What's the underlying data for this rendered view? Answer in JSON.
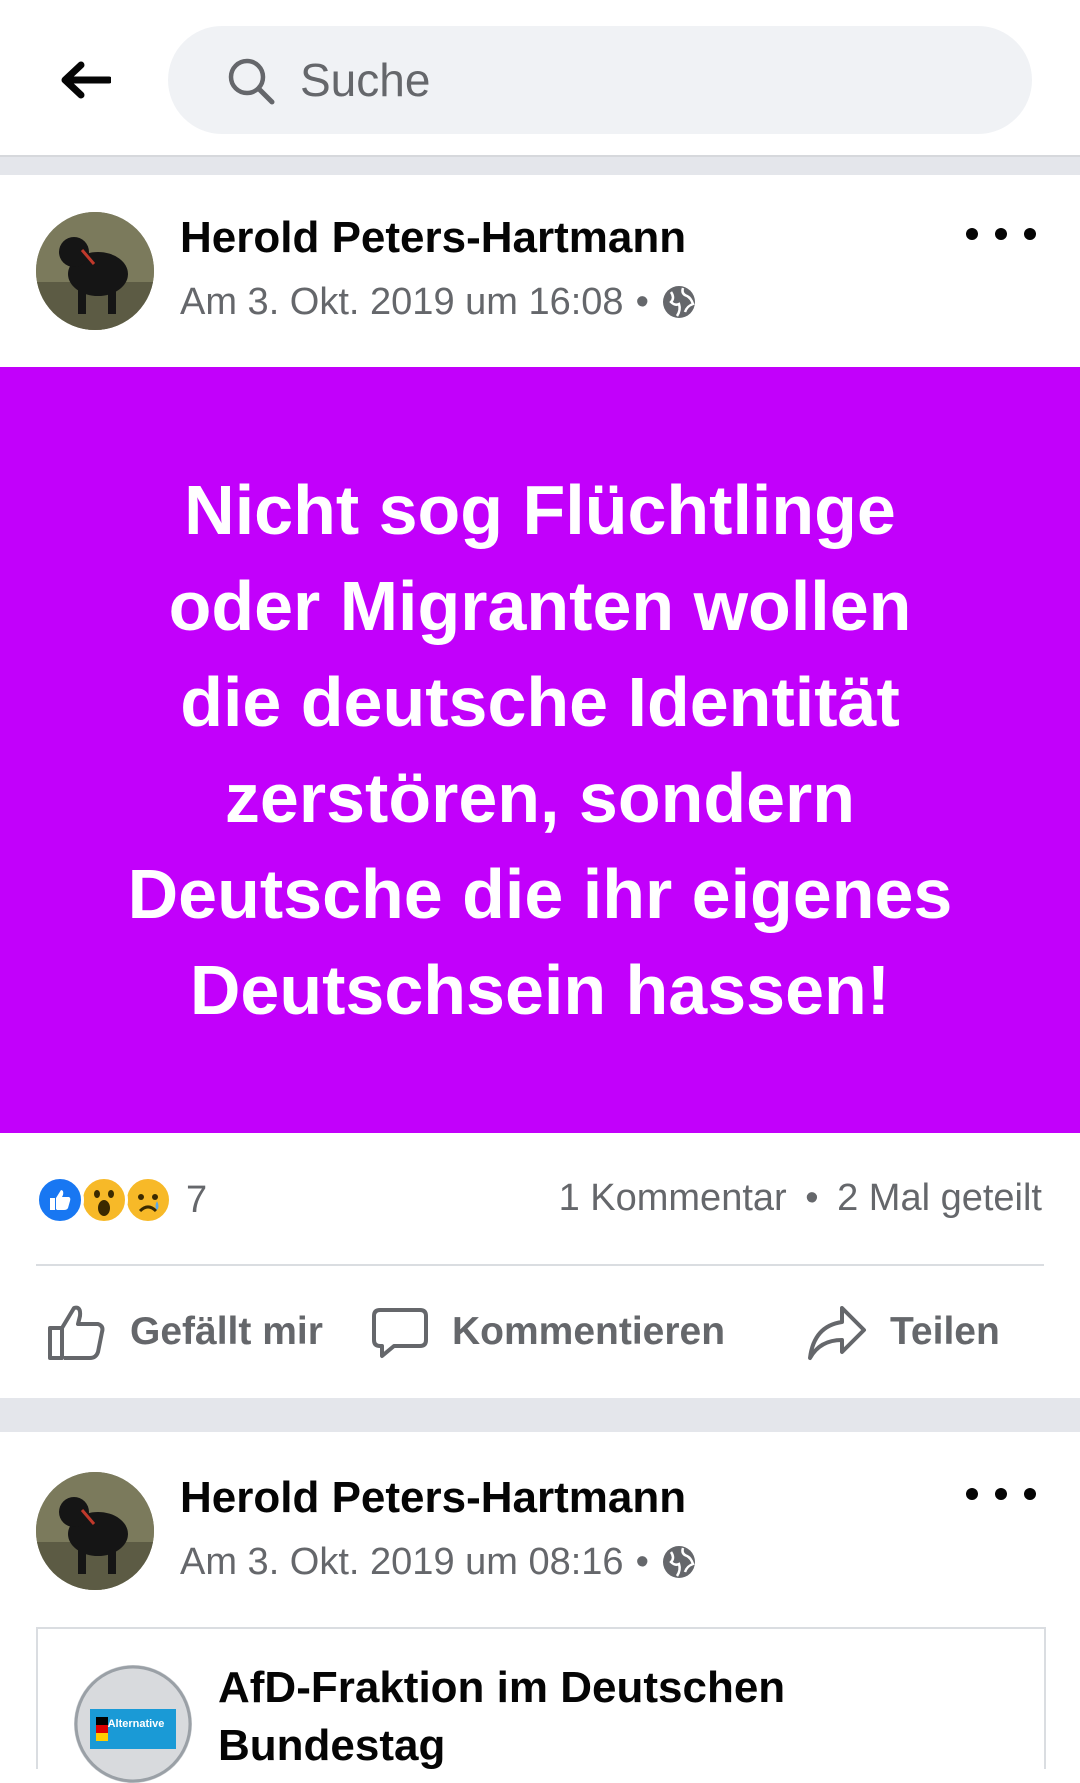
{
  "topbar": {
    "search_placeholder": "Suche"
  },
  "posts": [
    {
      "author": "Herold Peters-Hartmann",
      "timestamp": "Am 3. Okt. 2019 um 16:08",
      "separator": "•",
      "privacy_icon": "globe-icon",
      "text_lines": [
        "Nicht sog Flüchtlinge",
        "oder Migranten wollen",
        "die deutsche Identität",
        "zerstören, sondern",
        "Deutsche die ihr eigenes",
        "Deutschsein hassen!"
      ],
      "background_color": "#c200fb",
      "reaction_icons": [
        "like-icon",
        "wow-icon",
        "sad-icon"
      ],
      "reaction_count": "7",
      "comments": "1 Kommentar",
      "shares": "2 Mal geteilt",
      "actions": {
        "like": "Gefällt mir",
        "comment": "Kommentieren",
        "share": "Teilen"
      }
    },
    {
      "author": "Herold Peters-Hartmann",
      "timestamp": "Am 3. Okt. 2019 um 08:16",
      "separator": "•",
      "privacy_icon": "globe-icon",
      "shared_page": {
        "title": "AfD-Fraktion im Deutschen Bundestag",
        "logo_text": "Alternative"
      }
    }
  ],
  "colors": {
    "accent": "#1877f2",
    "secondary_text": "#65676b",
    "separator": "#e4e6eb"
  }
}
